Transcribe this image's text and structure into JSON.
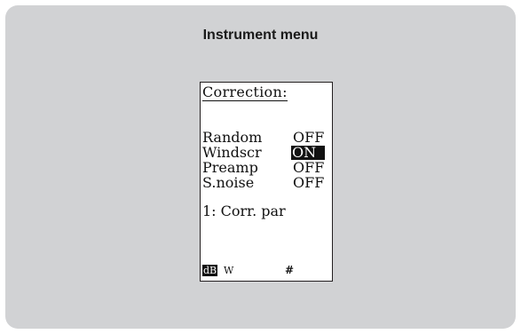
{
  "panel": {
    "title": "Instrument menu"
  },
  "screen": {
    "heading": "Correction:",
    "settings": [
      {
        "label": "Random",
        "value": "OFF",
        "selected": false
      },
      {
        "label": "Windscr",
        "value": "ON",
        "selected": true
      },
      {
        "label": "Preamp",
        "value": "OFF",
        "selected": false
      },
      {
        "label": "S.noise",
        "value": "OFF",
        "selected": false
      }
    ],
    "submenu": "1: Corr. par",
    "status": {
      "unit": "dB",
      "weighting": "W",
      "symbol": "#"
    }
  }
}
